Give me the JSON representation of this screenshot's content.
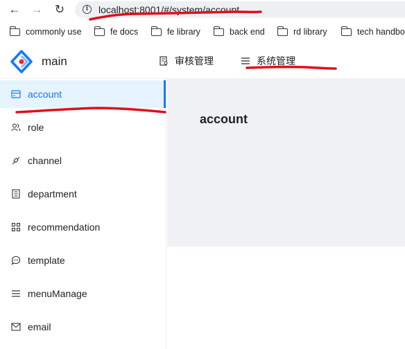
{
  "browser": {
    "url": "localhost:8001/#/system/account",
    "bookmarks": [
      "commonly use",
      "fe docs",
      "fe library",
      "back end",
      "rd library",
      "tech handbo"
    ]
  },
  "header": {
    "app_title": "main",
    "menu": [
      {
        "label": "审核管理",
        "icon": "audit-icon"
      },
      {
        "label": "系统管理",
        "icon": "menu-lines-icon"
      }
    ]
  },
  "sidebar": {
    "items": [
      {
        "label": "account",
        "icon": "card-icon",
        "active": true
      },
      {
        "label": "role",
        "icon": "users-icon"
      },
      {
        "label": "channel",
        "icon": "link-icon"
      },
      {
        "label": "department",
        "icon": "building-icon"
      },
      {
        "label": "recommendation",
        "icon": "grid-icon"
      },
      {
        "label": "template",
        "icon": "chat-icon"
      },
      {
        "label": "menuManage",
        "icon": "menu-lines-icon"
      },
      {
        "label": "email",
        "icon": "mail-icon"
      }
    ]
  },
  "main": {
    "title": "account"
  },
  "colors": {
    "accent": "#1677ff",
    "active_bg": "#e6f4ff",
    "annotation": "#e0101a",
    "content_bg": "#f0f1f4"
  }
}
